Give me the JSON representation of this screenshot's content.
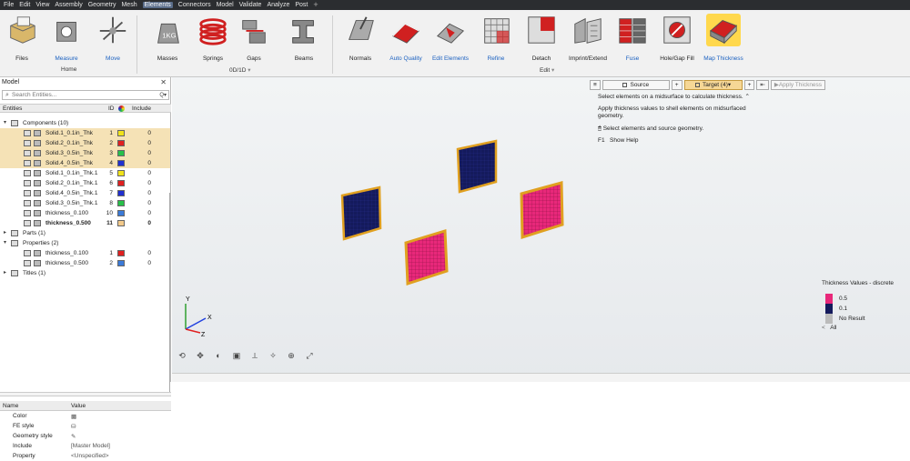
{
  "menubar": {
    "items": [
      "File",
      "Edit",
      "View",
      "Assembly",
      "Geometry",
      "Mesh",
      "Elements",
      "Connectors",
      "Model",
      "Validate",
      "Analyze",
      "Post"
    ],
    "active_index": 6
  },
  "ribbon": {
    "tools": [
      {
        "label": "Files",
        "icon": "files-icon",
        "blue": false
      },
      {
        "label": "Measure",
        "icon": "measure-icon",
        "blue": true
      },
      {
        "label": "Move",
        "icon": "move-icon",
        "blue": true
      },
      {
        "label": "Masses",
        "icon": "masses-icon",
        "blue": false
      },
      {
        "label": "Springs",
        "icon": "springs-icon",
        "blue": false
      },
      {
        "label": "Gaps",
        "icon": "gaps-icon",
        "blue": false
      },
      {
        "label": "Beams",
        "icon": "beams-icon",
        "blue": false
      },
      {
        "label": "Normals",
        "icon": "normals-icon",
        "blue": false
      },
      {
        "label": "Auto Quality",
        "icon": "auto-quality-icon",
        "blue": true
      },
      {
        "label": "Edit Elements",
        "icon": "edit-elements-icon",
        "blue": true
      },
      {
        "label": "Refine",
        "icon": "refine-icon",
        "blue": true
      },
      {
        "label": "Detach",
        "icon": "detach-icon",
        "blue": false
      },
      {
        "label": "Imprint/Extend",
        "icon": "imprint-extend-icon",
        "blue": false
      },
      {
        "label": "Fuse",
        "icon": "fuse-icon",
        "blue": true
      },
      {
        "label": "Hole/Gap Fill",
        "icon": "hole-gap-fill-icon",
        "blue": false
      },
      {
        "label": "Map Thickness",
        "icon": "map-thickness-icon",
        "blue": true
      }
    ],
    "groups": {
      "home": "Home",
      "zero_d": "0D/1D",
      "edit": "Edit"
    },
    "mass_badge": "1KG"
  },
  "model_panel": {
    "title": "Model",
    "search_placeholder": "Search Entities...",
    "headers": {
      "entities": "Entities",
      "id": "ID",
      "include": "Include"
    },
    "tree": [
      {
        "name": "Components (10)",
        "level": 0,
        "twisty": "▾"
      },
      {
        "name": "Solid.1_0.1in_Thk",
        "id": "1",
        "color": "#f0e21a",
        "include": "0",
        "sel": true
      },
      {
        "name": "Solid.2_0.1in_Thk",
        "id": "2",
        "color": "#e02020",
        "include": "0",
        "sel": true
      },
      {
        "name": "Solid.3_0.5in_Thk",
        "id": "3",
        "color": "#27c04a",
        "include": "0",
        "sel": true
      },
      {
        "name": "Solid.4_0.5in_Thk",
        "id": "4",
        "color": "#2030d0",
        "include": "0",
        "sel": true
      },
      {
        "name": "Solid.1_0.1in_Thk.1",
        "id": "5",
        "color": "#f0e21a",
        "include": "0"
      },
      {
        "name": "Solid.2_0.1in_Thk.1",
        "id": "6",
        "color": "#e02020",
        "include": "0"
      },
      {
        "name": "Solid.4_0.5in_Thk.1",
        "id": "7",
        "color": "#2030d0",
        "include": "0"
      },
      {
        "name": "Solid.3_0.5in_Thk.1",
        "id": "8",
        "color": "#27c04a",
        "include": "0"
      },
      {
        "name": "thickness_0.100",
        "id": "10",
        "color": "#3b7ad8",
        "include": "0"
      },
      {
        "name": "thickness_0.500",
        "id": "11",
        "color": "#f2c98a",
        "include": "0",
        "bold": true
      },
      {
        "name": "Parts (1)",
        "level": 0,
        "twisty": "▸"
      },
      {
        "name": "Properties (2)",
        "level": 0,
        "twisty": "▾"
      },
      {
        "name": "thickness_0.100",
        "id": "1",
        "color": "#e02020",
        "include": "0"
      },
      {
        "name": "thickness_0.500",
        "id": "2",
        "color": "#3b7ad8",
        "include": "0"
      },
      {
        "name": "Titles (1)",
        "level": 0,
        "twisty": "▸"
      }
    ],
    "props": {
      "headers": {
        "name": "Name",
        "value": "Value"
      },
      "rows": [
        {
          "k": "Color",
          "v": ""
        },
        {
          "k": "FE style",
          "v": ""
        },
        {
          "k": "Geometry style",
          "v": ""
        },
        {
          "k": "Include",
          "v": "[Master Model]"
        },
        {
          "k": "Property",
          "v": "<Unspecified>"
        }
      ]
    }
  },
  "guidebar": {
    "menu": "≡",
    "source": "Source",
    "add": "+",
    "target": "Target (4)",
    "add2": "+",
    "prev": "⇤",
    "apply": "Apply Thickness"
  },
  "guide": {
    "line1": "Select elements on a midsurface to calculate thickness.",
    "line2": "Apply thickness values to shell elements on midsurfaced geometry.",
    "line3": "Select elements and source geometry.",
    "line4_key": "F1",
    "line4": "Show Help"
  },
  "legend": {
    "title": "Thickness Values - discrete",
    "items": [
      {
        "label": "0.5",
        "color": "#e8287a"
      },
      {
        "label": "0.1",
        "color": "#141a5c"
      },
      {
        "label": "No Result",
        "color": "#bbbbbb"
      }
    ],
    "all": "All"
  },
  "triad": {
    "x": "X",
    "y": "Y",
    "z": "Z"
  },
  "colors": {
    "menubar": "#2b2d30",
    "selection": "#f5e2b6",
    "target": "#f6d796"
  }
}
